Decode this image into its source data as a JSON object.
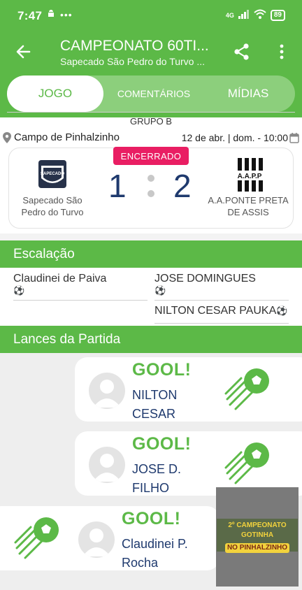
{
  "status_bar": {
    "time": "7:47",
    "network": "4G",
    "battery": "89",
    "notification_icons": [
      "android-icon",
      "dots-icon"
    ]
  },
  "header": {
    "title": "CAMPEONATO 60TI...",
    "subtitle": "Sapecado São Pedro do Turvo  ..."
  },
  "tabs": [
    {
      "label": "JOGO",
      "active": true
    },
    {
      "label": "COMENTÁRIOS",
      "active": false
    },
    {
      "label": "MÍDIAS",
      "active": false
    }
  ],
  "match": {
    "group": "GRUPO B",
    "venue": "Campo de Pinhalzinho",
    "date": "12 de abr. | dom. - 10:00",
    "status": "ENCERRADO",
    "home": {
      "name": "Sapecado São Pedro do Turvo",
      "score": "1",
      "logo_text": "SAPECADO"
    },
    "away": {
      "name": "A.A.PONTE PRETA DE ASSIS",
      "score": "2",
      "logo_text": "A.A.P.P"
    }
  },
  "lineup": {
    "title": "Escalação",
    "home": [
      {
        "name": "Claudinei de Paiva",
        "goal_icon": "⚽"
      }
    ],
    "away": [
      {
        "name": "JOSE DOMINGUES",
        "goal_icon": "⚽"
      },
      {
        "name": "NILTON CESAR PAUKA",
        "goal_icon": "⚽"
      }
    ]
  },
  "events": {
    "title": "Lances da Partida",
    "items": [
      {
        "label": "GOOL!",
        "line1": "NILTON",
        "line2": "CESAR",
        "side": "away"
      },
      {
        "label": "GOOL!",
        "line1": "JOSE D.",
        "line2": "FILHO",
        "side": "away"
      },
      {
        "label": "GOOL!",
        "line1": "Claudinei P.",
        "line2": "Rocha",
        "side": "home"
      }
    ]
  },
  "ad": {
    "line1": "2º CAMPEONATO GOTINHA",
    "line2": "NO PINHALZINHO"
  },
  "colors": {
    "primary": "#5cb947",
    "score_blue": "#1f3a6e",
    "badge_pink": "#e91e63"
  }
}
